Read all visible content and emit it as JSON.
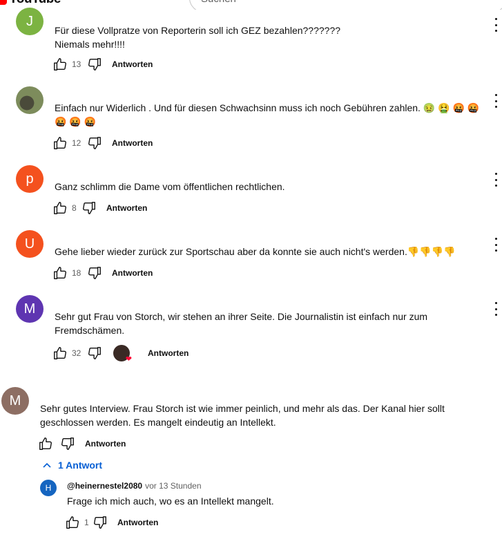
{
  "header": {
    "logo_text": "YouTube",
    "search_placeholder": "Suchen"
  },
  "reply_label": "Antworten",
  "replies_toggle": "1 Antwort",
  "comments": [
    {
      "avatar_letter": "J",
      "avatar_color": "#7cb342",
      "text_lines": [
        "Für diese  Vollpratze von Reporterin soll ich GEZ bezahlen???????",
        "Niemals mehr!!!!"
      ],
      "likes": "13"
    },
    {
      "avatar_letter": "",
      "avatar_color": "#6d7b5a",
      "text_lines": [
        "Einfach nur Widerlich . Und für diesen Schwachsinn muss ich noch Gebühren zahlen. 🤢 🤮 🤬 🤬",
        "🤬 🤬 🤬"
      ],
      "likes": "12"
    },
    {
      "avatar_letter": "p",
      "avatar_color": "#f4511e",
      "text_lines": [
        "Ganz schlimm  die Dame vom öffentlichen rechtlichen."
      ],
      "likes": "8"
    },
    {
      "avatar_letter": "U",
      "avatar_color": "#f4511e",
      "text_lines": [
        "Gehe lieber wieder zurück zur Sportschau aber da konnte sie auch nicht's werden.👎👎👎👎"
      ],
      "likes": "18"
    },
    {
      "avatar_letter": "M",
      "avatar_color": "#5e35b1",
      "text_lines": [
        "Sehr gut Frau von Storch, wir stehen an ihrer Seite. Die Journalistin ist einfach nur zum",
        "Fremdschämen."
      ],
      "likes": "32"
    },
    {
      "avatar_letter": "M",
      "avatar_color": "#8d6e63",
      "text_lines": [
        "Sehr gutes Interview. Frau Storch ist wie immer peinlich, und mehr als das. Der Kanal hier sollt",
        "geschlossen werden. Es mangelt eindeutig an Intellekt."
      ],
      "likes": ""
    }
  ],
  "reply": {
    "avatar_letter": "H",
    "avatar_color": "#1565c0",
    "author": "@heinernestel2080",
    "time": "vor 13 Stunden",
    "text": "Frage ich mich auch, wo es an Intellekt mangelt.",
    "likes": "1"
  }
}
